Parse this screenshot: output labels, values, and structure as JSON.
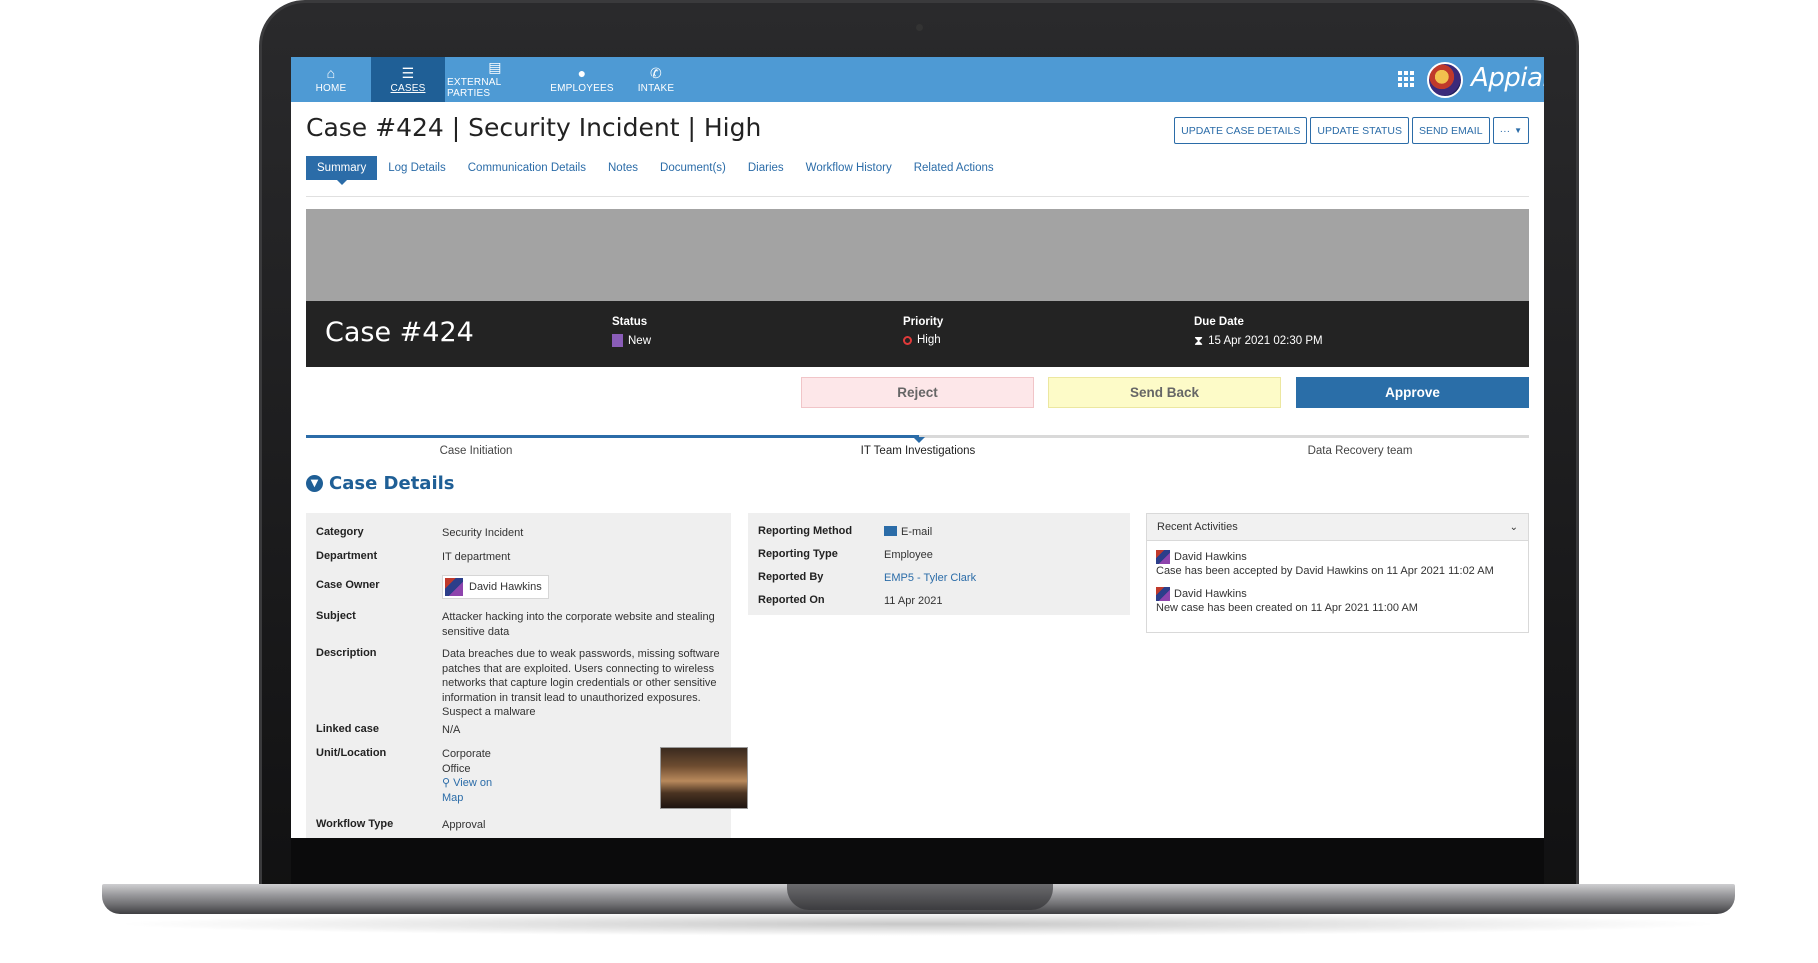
{
  "nav": {
    "items": [
      {
        "label": "HOME",
        "icon": "home-icon"
      },
      {
        "label": "CASES",
        "icon": "list-icon"
      },
      {
        "label": "EXTERNAL PARTIES",
        "icon": "book-icon"
      },
      {
        "label": "EMPLOYEES",
        "icon": "user-icon"
      },
      {
        "label": "INTAKE",
        "icon": "phone-icon"
      }
    ],
    "active": "CASES",
    "brand": "Appian"
  },
  "header": {
    "title": "Case #424 | Security Incident | High",
    "buttons": [
      "UPDATE CASE DETAILS",
      "UPDATE STATUS",
      "SEND EMAIL",
      "···"
    ]
  },
  "tabs": [
    "Summary",
    "Log Details",
    "Communication Details",
    "Notes",
    "Document(s)",
    "Diaries",
    "Workflow History",
    "Related Actions"
  ],
  "banner": {
    "case": "Case #424",
    "status_label": "Status",
    "status_value": "New",
    "priority_label": "Priority",
    "priority_value": "High",
    "due_label": "Due Date",
    "due_value": "15 Apr 2021 02:30 PM"
  },
  "actions": {
    "reject": "Reject",
    "send_back": "Send Back",
    "approve": "Approve"
  },
  "stepper": {
    "steps": [
      "Case Initiation",
      "IT Team Investigations",
      "Data Recovery team"
    ],
    "current": "IT Team Investigations"
  },
  "section": {
    "title": "Case Details"
  },
  "details": {
    "category_k": "Category",
    "category_v": "Security Incident",
    "department_k": "Department",
    "department_v": "IT department",
    "owner_k": "Case Owner",
    "owner_v": "David Hawkins",
    "subject_k": "Subject",
    "subject_v": "Attacker hacking into the corporate website and stealing sensitive data",
    "description_k": "Description",
    "description_v": "Data breaches due to weak passwords, missing software patches that are exploited. Users connecting to wireless networks that capture login credentials or other sensitive information in transit lead to unauthorized exposures. Suspect a malware",
    "linked_k": "Linked case",
    "linked_v": "N/A",
    "location_k": "Unit/Location",
    "location_v": "Corporate Office",
    "location_link": "View on Map",
    "workflow_k": "Workflow Type",
    "workflow_v": "Approval"
  },
  "reporting": {
    "method_k": "Reporting Method",
    "method_v": "E-mail",
    "type_k": "Reporting Type",
    "type_v": "Employee",
    "by_k": "Reported By",
    "by_v": "EMP5 - Tyler  Clark",
    "on_k": "Reported On",
    "on_v": "11 Apr 2021"
  },
  "recent": {
    "title": "Recent Activities",
    "items": [
      {
        "who": "David Hawkins",
        "text": "Case has been accepted by David Hawkins on 11 Apr 2021 11:02 AM"
      },
      {
        "who": "David Hawkins",
        "text": "New case has been created on 11 Apr 2021 11:00 AM"
      }
    ]
  },
  "colors": {
    "nav": "#4e9ad4",
    "nav_active": "#1f5f96",
    "accent": "#2b6ca8",
    "banner_dark": "#232323"
  }
}
